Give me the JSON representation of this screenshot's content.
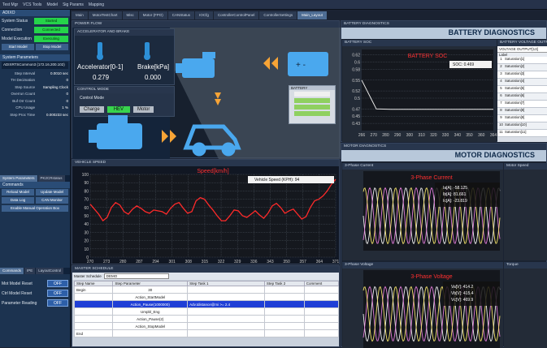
{
  "window": {
    "menu": [
      "Test Mgr",
      "VCS Tools",
      "Model",
      "Sig Params",
      "Mapping"
    ]
  },
  "tabs": [
    "Main",
    "MotorTestChart",
    "Misc",
    "Motor (FPO)",
    "CANStatus",
    "IOCfg",
    "ControllerControlPanel",
    "ControllerSettings",
    "Main_Layout"
  ],
  "left": {
    "title": "ADIXO",
    "status": [
      {
        "k": "System Status",
        "v": "Started"
      },
      {
        "k": "Connection",
        "v": "Connected"
      },
      {
        "k": "Model Execution",
        "v": "Executing"
      }
    ],
    "buttons": [
      "Start Model",
      "Stop Model"
    ],
    "params_title": "System Parameters",
    "target": "ADIXRTSCommon3 (172.16.200.102)",
    "params": [
      {
        "k": "Step Interval",
        "v": "0.0010 sec"
      },
      {
        "k": "TH Decimation",
        "v": "0"
      },
      {
        "k": "Step Source",
        "v": "Sampling Clock"
      },
      {
        "k": "Overrun Count",
        "v": "0"
      },
      {
        "k": "Buf Orr Count",
        "v": "0"
      },
      {
        "k": "CPU Usage",
        "v": "1 %"
      },
      {
        "k": "Step Proc Time",
        "v": "0.000233 sec"
      }
    ],
    "subtabs": [
      "System Parameters",
      "PK2CRstatus"
    ],
    "commands_title": "Commands",
    "commands": [
      "Reload Model",
      "Update Model",
      "Data Log",
      "CAN Monitor"
    ],
    "wide_cmd": "Enable Manual Operation Box",
    "bottom_tabs": [
      "Commands",
      "IPE",
      "LayoutControl"
    ],
    "toggles": [
      {
        "k": "Mot Model Reset",
        "v": "OFF"
      },
      {
        "k": "Ctrl Model Reset",
        "v": "OFF"
      },
      {
        "k": "Parameter Reading",
        "v": "OFF"
      }
    ]
  },
  "power": {
    "title": "POWER FLOW",
    "accel_title": "ACCELERATOR AND BRAKE",
    "accel_label": "Accelerator[0-1]",
    "brake_label": "Brake[kPa]",
    "accel_val": "0.279",
    "brake_val": "0.000",
    "mode_title": "CONTROL MODE",
    "mode_label": "Control Mode",
    "modes": [
      "Charge",
      "HEV",
      "Motor"
    ],
    "battery_label": "BATTERY"
  },
  "speed": {
    "title": "VEHICLE SPEED",
    "chart_title": "Speed[km/h]",
    "legend": "Vehicle Speed (KPH): 94"
  },
  "schedule": {
    "title": "MASTER SCHEDULE",
    "bar_label": "Master Schedule",
    "bar_value": "DEMO",
    "cols": [
      "Step Name",
      "Step Parameter",
      "Step Task 1",
      "Step Task 2",
      "Comment"
    ],
    "rows": [
      [
        "Begin",
        "30",
        "",
        "",
        ""
      ],
      [
        "",
        "Action_StartModel",
        "",
        "",
        ""
      ],
      [
        "",
        "Action_Pause(1000000)",
        "Adv.tdistance@mi >= 2.4",
        "",
        ""
      ],
      [
        "",
        "Umpbl_Eng",
        "",
        "",
        ""
      ],
      [
        "",
        "Action_Pause(2)",
        "",
        "",
        ""
      ],
      [
        "",
        "Action_StopModel",
        "",
        "",
        ""
      ],
      [
        "End",
        "",
        "",
        "",
        ""
      ]
    ]
  },
  "battery": {
    "title": "BATTERY DIAGNOSTICS",
    "header": "BATTERY DIAGNOSTICS",
    "soc_title": "BATTERY SOC",
    "chart_title": "BATTERY SOC",
    "legend": "SOC: 0.469",
    "volt_title": "BATTERY VOLTAGE OUTPUT",
    "volt_header": "VOLTAGE OUTPUT[13]",
    "volt_col": "Label",
    "cells": [
      "Saturation[1]",
      "Saturation[2]",
      "Saturation[3]",
      "Saturation[4]",
      "Saturation[5]",
      "Saturation[6]",
      "Saturation[7]",
      "Saturation[8]",
      "Saturation[9]",
      "Saturation[10]",
      "Saturation[11]"
    ]
  },
  "motor": {
    "title": "MOTOR DIAGNOSTICS",
    "header": "MOTOR DIAGNOSTICS",
    "current_title": "3-Phase Current",
    "current_chart": "3-Phase Current",
    "ia": "Ia[A]: -58.125",
    "ib": "Ib[A]: 81.661",
    "ic": "Ic[A]: -23.819",
    "speed_title": "Motor Speed",
    "voltage_title": "3-Phase Voltage",
    "voltage_chart": "3-Phase Voltage",
    "va": "Va[V]: 414.2",
    "vb": "Vb[V]: 415.4",
    "vc": "Vc[V]: 469.9",
    "torque_title": "Torque"
  },
  "chart_data": [
    {
      "type": "line",
      "title": "Speed[km/h]",
      "series": [
        {
          "name": "Vehicle Speed (KPH): 94",
          "values": [
            64,
            58,
            52,
            44,
            48,
            60,
            66,
            63,
            55,
            52,
            58,
            62,
            59,
            55,
            53,
            57,
            56,
            55,
            52,
            59,
            64,
            66,
            59,
            53,
            55,
            68,
            72,
            70,
            63,
            57,
            50,
            44,
            44,
            50,
            57,
            56,
            50,
            48,
            52,
            56,
            51,
            47,
            53,
            62,
            65,
            60,
            53,
            56,
            58,
            52,
            46,
            49,
            60,
            68,
            70,
            74,
            80,
            88,
            94
          ]
        }
      ],
      "x": [
        270,
        273,
        280,
        287,
        294,
        301,
        308,
        315,
        322,
        329,
        336,
        343,
        350,
        357,
        364,
        371
      ],
      "ylim": [
        0,
        100
      ],
      "yticks": [
        0,
        10,
        20,
        30,
        40,
        50,
        60,
        70,
        80,
        90,
        100
      ]
    },
    {
      "type": "line",
      "title": "BATTERY SOC",
      "series": [
        {
          "name": "SOC: 0.469",
          "values": [
            0.55,
            0.47,
            0.469,
            0.469,
            0.469,
            0.469,
            0.469,
            0.469,
            0.469,
            0.469
          ]
        }
      ],
      "x": [
        266,
        270,
        280,
        290,
        300,
        310,
        320,
        330,
        340,
        350,
        360,
        364
      ],
      "ylim": [
        0.41,
        0.635
      ],
      "yticks": [
        0.43,
        0.45,
        0.47,
        0.5,
        0.52,
        0.55,
        0.58,
        0.6,
        0.62
      ]
    }
  ]
}
